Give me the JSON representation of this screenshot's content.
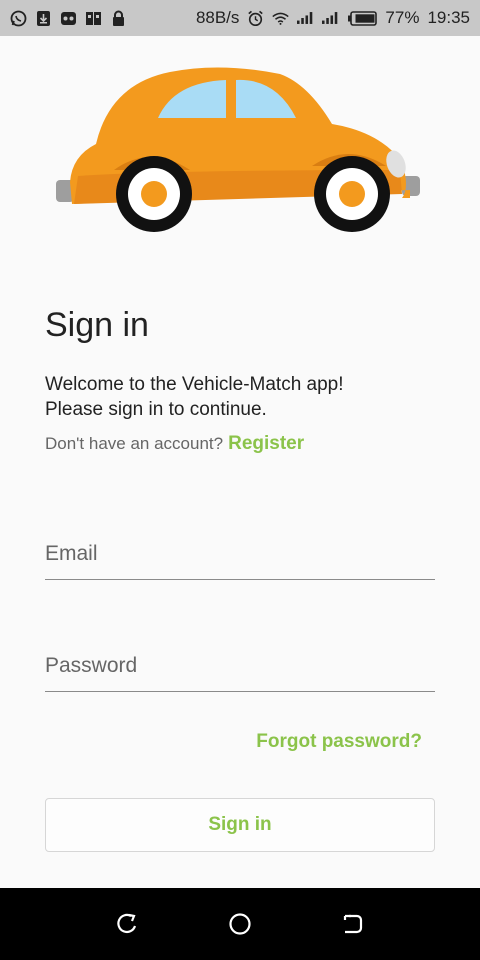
{
  "status_bar": {
    "net_speed": "88B/s",
    "battery": "77%",
    "time": "19:35",
    "left_icons": [
      "whatsapp-icon",
      "download-icon",
      "gamepad-icon",
      "sim-icon",
      "lock-icon"
    ],
    "right_icons": [
      "alarm-icon",
      "wifi-icon",
      "signal-icon",
      "signal-icon",
      "battery-icon"
    ]
  },
  "signin": {
    "title": "Sign in",
    "welcome_line1": "Welcome to the Vehicle-Match app!",
    "welcome_line2": "Please sign in to continue.",
    "no_account": "Don't have an account?",
    "register": "Register",
    "email_placeholder": "Email",
    "password_placeholder": "Password",
    "forgot": "Forgot password?",
    "button": "Sign in"
  },
  "nav": {
    "back_icon": "back-icon",
    "home_icon": "home-icon",
    "recents_icon": "recents-icon"
  },
  "colors": {
    "accent": "#8bc34a",
    "car_body": "#f39a1e",
    "car_window": "#a9dcf5"
  }
}
